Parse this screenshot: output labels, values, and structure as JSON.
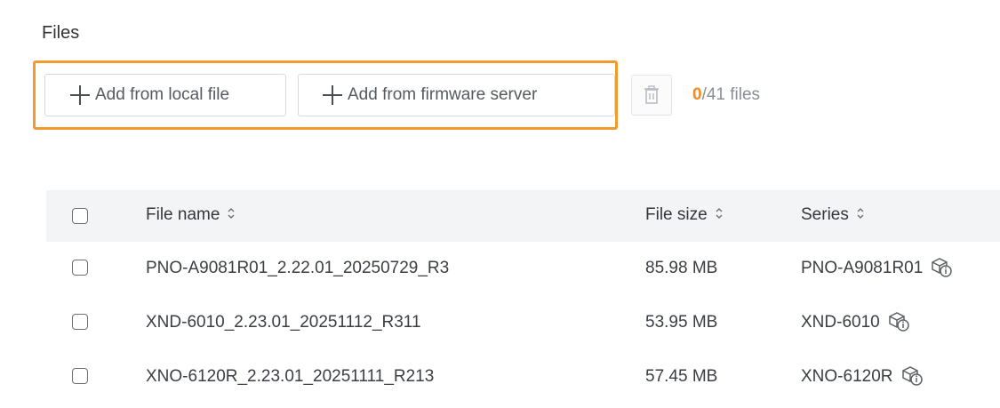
{
  "files_section": {
    "title": "Files",
    "add_local_label": "Add from local file",
    "add_server_label": "Add from firmware server",
    "selected_count": "0",
    "total_label": "/41 files",
    "highlight_color": "#f39a2e",
    "selected_color": "#f08a24"
  },
  "table": {
    "headers": {
      "file_name": "File name",
      "file_size": "File size",
      "series": "Series"
    },
    "rows": [
      {
        "file_name": "PNO-A9081R01_2.22.01_20250729_R3",
        "file_size": "85.98 MB",
        "series": "PNO-A9081R01"
      },
      {
        "file_name": "XND-6010_2.23.01_20251112_R311",
        "file_size": "53.95 MB",
        "series": "XND-6010"
      },
      {
        "file_name": "XNO-6120R_2.23.01_20251111_R213",
        "file_size": "57.45 MB",
        "series": "XNO-6120R"
      }
    ]
  },
  "icons": {
    "add": "plus-icon",
    "delete": "trash-icon",
    "sort": "sort-icon",
    "series_info": "package-info-icon"
  }
}
